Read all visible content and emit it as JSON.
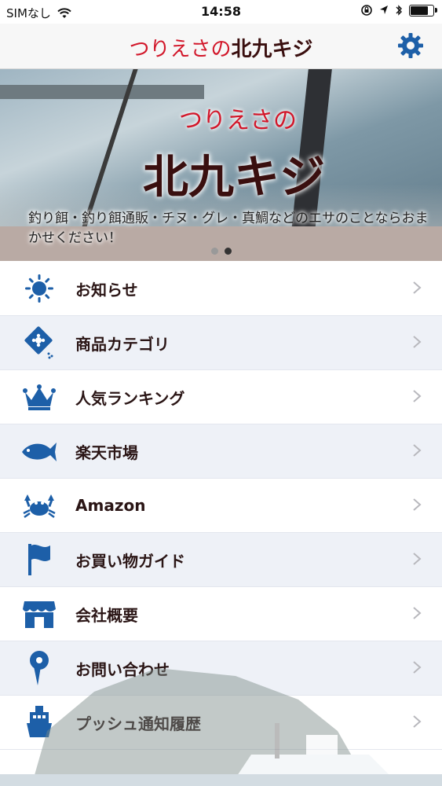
{
  "status": {
    "carrier": "SIMなし",
    "time": "14:58",
    "battery_level": 0.85
  },
  "header": {
    "logo_red": "つりえさの",
    "logo_dark": "北九キジ",
    "settings_icon": "gear-icon"
  },
  "banner": {
    "title_red": "つりえさの",
    "title_dark": "北九キジ",
    "tagline": "釣り餌・釣り餌通販・チヌ・グレ・真鯛などのエサのことならおまかせください！",
    "page_count": 2,
    "active_page": 1
  },
  "colors": {
    "accent": "#1d5fa8",
    "logo_red": "#d2172a",
    "text_dark": "#2a1515"
  },
  "menu": {
    "items": [
      {
        "label": "お知らせ",
        "icon": "sun-icon"
      },
      {
        "label": "商品カテゴリ",
        "icon": "bait-pack-icon"
      },
      {
        "label": "人気ランキング",
        "icon": "crown-icon"
      },
      {
        "label": "楽天市場",
        "icon": "fish-icon"
      },
      {
        "label": "Amazon",
        "icon": "crab-icon"
      },
      {
        "label": "お買い物ガイド",
        "icon": "flag-icon"
      },
      {
        "label": "会社概要",
        "icon": "store-icon"
      },
      {
        "label": "お問い合わせ",
        "icon": "map-pin-icon"
      },
      {
        "label": "プッシュ通知履歴",
        "icon": "ship-icon"
      }
    ]
  }
}
